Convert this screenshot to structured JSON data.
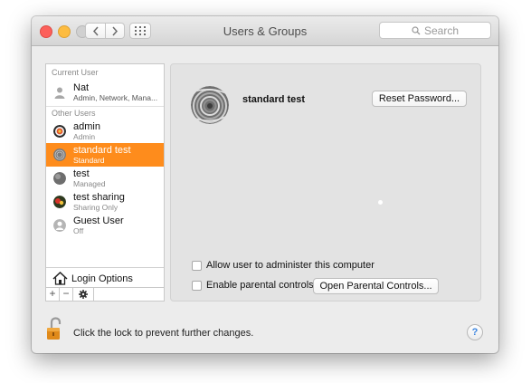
{
  "window": {
    "title": "Users & Groups",
    "search_placeholder": "Search"
  },
  "sidebar": {
    "current_user_header": "Current User",
    "current_user": {
      "name": "Nat",
      "role": "Admin, Network, Mana..."
    },
    "other_users_header": "Other Users",
    "other_users": [
      {
        "name": "admin",
        "role": "Admin"
      },
      {
        "name": "standard test",
        "role": "Standard",
        "selected": true
      },
      {
        "name": "test",
        "role": "Managed"
      },
      {
        "name": "test sharing",
        "role": "Sharing Only"
      },
      {
        "name": "Guest User",
        "role": "Off"
      }
    ],
    "login_options_label": "Login Options",
    "add_label": "+",
    "remove_label": "−"
  },
  "detail": {
    "full_name": "standard test",
    "reset_password_label": "Reset Password...",
    "allow_admin_label": "Allow user to administer this computer",
    "parental_controls_label": "Enable parental controls",
    "open_parental_controls_label": "Open Parental Controls..."
  },
  "footer": {
    "lock_text": "Click the lock to prevent further changes.",
    "help_label": "?"
  },
  "colors": {
    "selection": "#fe8c1c",
    "close": "#fc605b",
    "minimize": "#fdbc40"
  },
  "icons": [
    "back-icon",
    "forward-icon",
    "grid-icon",
    "search-icon",
    "house-icon",
    "gear-icon",
    "lock-icon",
    "help-icon"
  ]
}
